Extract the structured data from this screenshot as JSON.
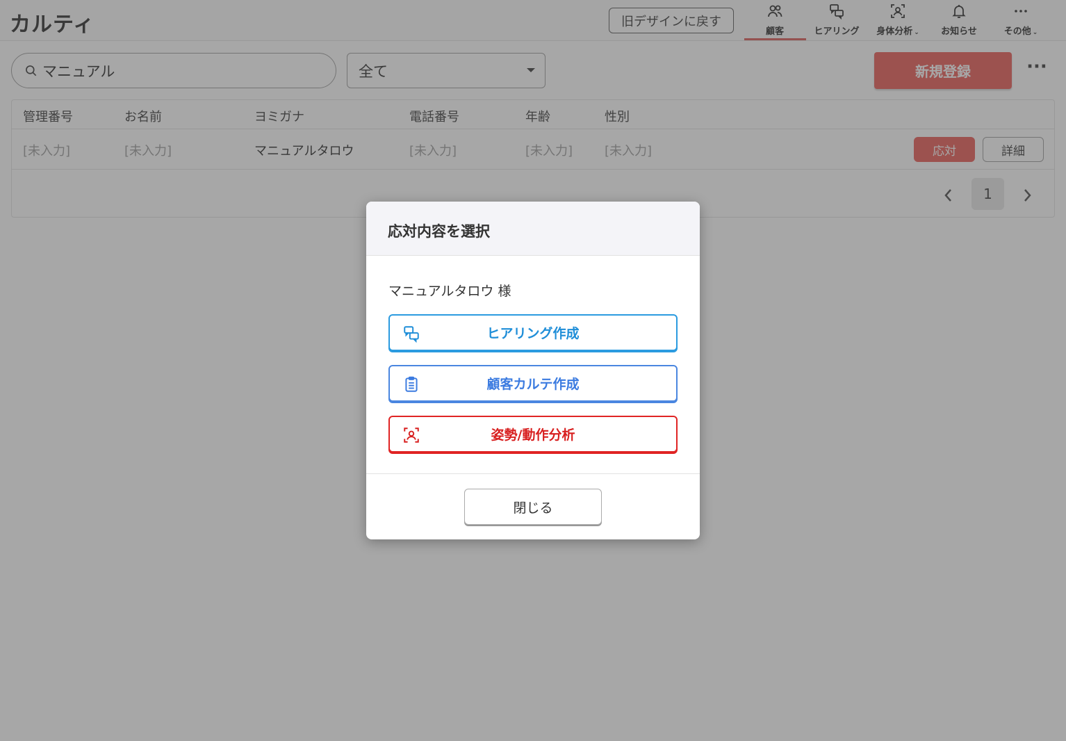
{
  "header": {
    "logo": "カルティ",
    "old_design_label": "旧デザインに戻す",
    "nav": [
      {
        "label": "顧客",
        "icon": "users-icon",
        "active": true
      },
      {
        "label": "ヒアリング",
        "icon": "chat-icon"
      },
      {
        "label": "身体分析",
        "icon": "body-scan-icon",
        "dropdown": "⌄"
      },
      {
        "label": "お知らせ",
        "icon": "bell-icon"
      },
      {
        "label": "その他",
        "icon": "ellipsis-icon",
        "dropdown": "⌄"
      }
    ]
  },
  "toolbar": {
    "search_value": "マニュアル",
    "filter_value": "全て",
    "new_label": "新規登録",
    "more_label": "···"
  },
  "table": {
    "columns": [
      "管理番号",
      "お名前",
      "ヨミガナ",
      "電話番号",
      "年齢",
      "性別"
    ],
    "rows": [
      {
        "id": "[未入力]",
        "name": "[未入力]",
        "kana": "マニュアルタロウ",
        "phone": "[未入力]",
        "age": "[未入力]",
        "gender": "[未入力]",
        "respond_label": "応対",
        "detail_label": "詳細"
      }
    ],
    "pagination": {
      "current": "1"
    }
  },
  "modal": {
    "title": "応対内容を選択",
    "customer": "マニュアルタロウ 様",
    "actions": [
      {
        "label": "ヒアリング作成",
        "icon": "chat-icon",
        "color": "#1f8ed8"
      },
      {
        "label": "顧客カルテ作成",
        "icon": "clipboard-icon",
        "color": "#3b7be0"
      },
      {
        "label": "姿勢/動作分析",
        "icon": "body-scan-icon",
        "color": "#d81f1f"
      }
    ],
    "close_label": "閉じる"
  },
  "colors": {
    "accent": "#e8554e",
    "overlay": "#505050"
  }
}
